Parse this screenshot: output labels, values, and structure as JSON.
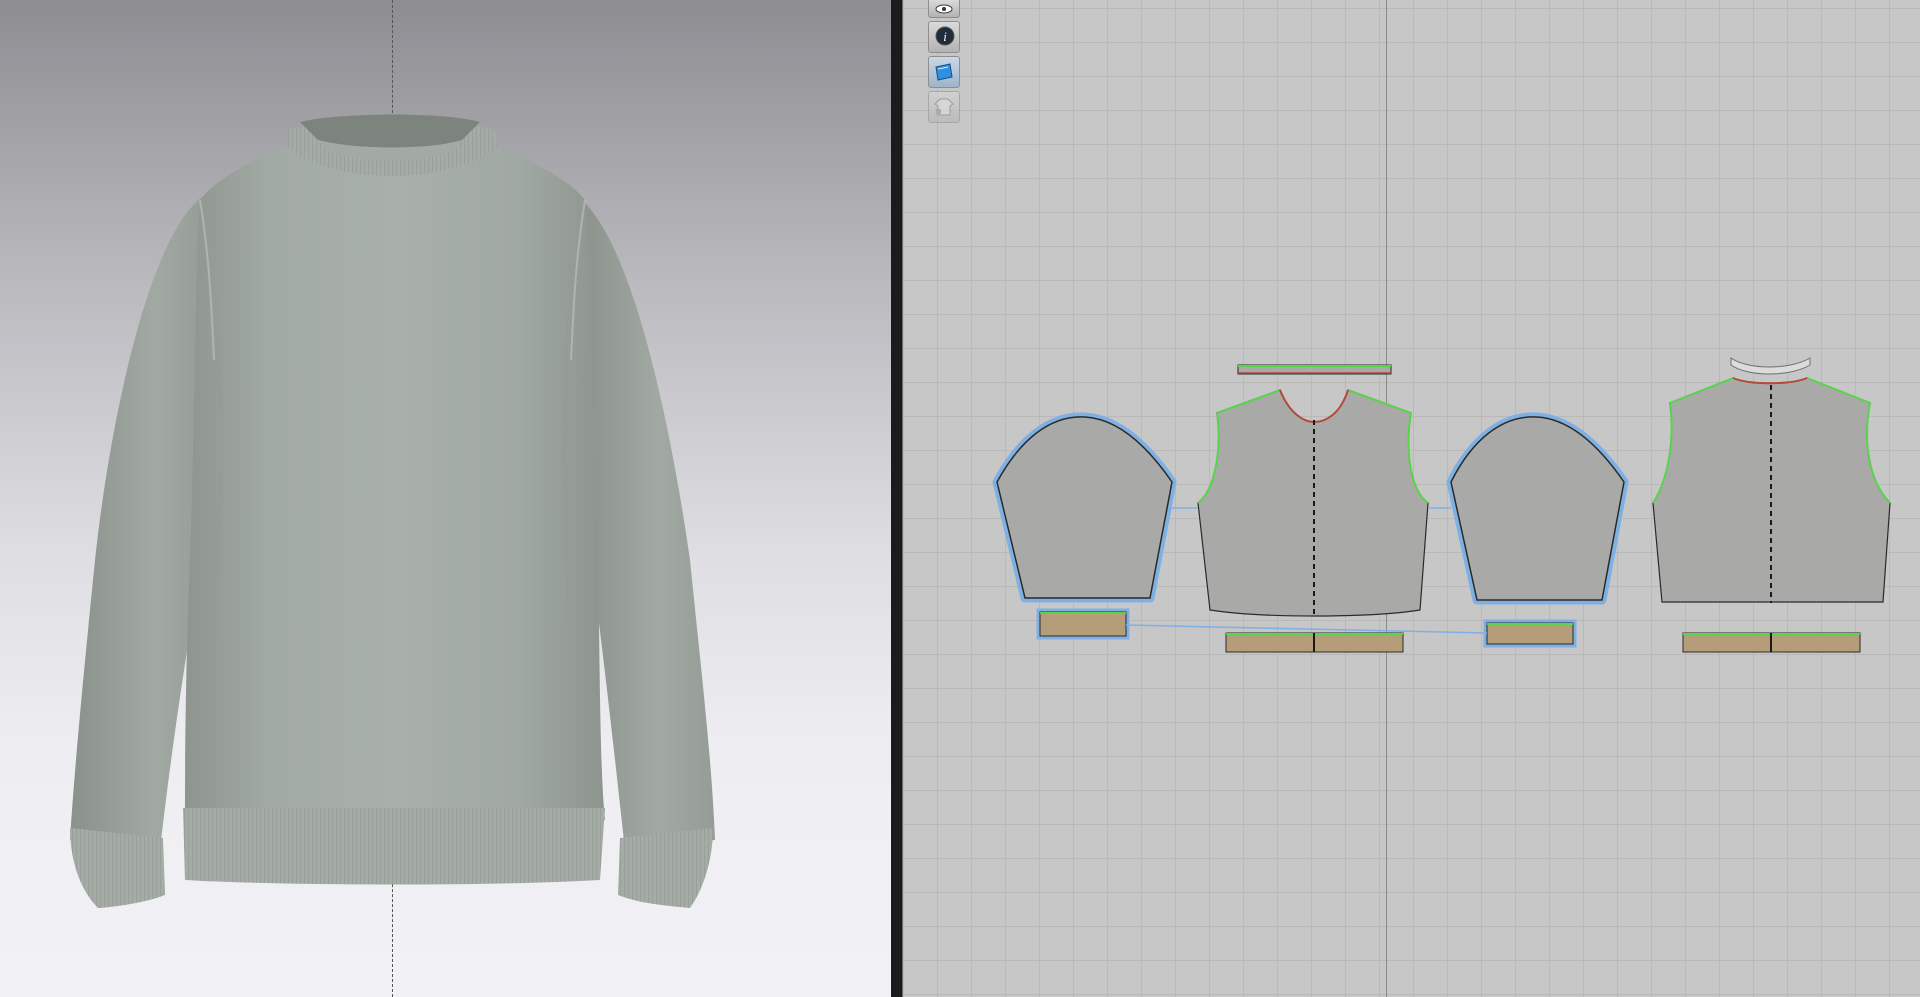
{
  "app": {
    "panes": [
      "3d-garment-window",
      "2d-pattern-window"
    ]
  },
  "viewport_3d": {
    "background_top": "#8d8d92",
    "background_bottom": "#f2f2f5",
    "garment_color": "#a2aaa4"
  },
  "viewport_2d": {
    "background": "#c7c7c7",
    "grid_color": "#b9b9b9",
    "toolbar": [
      {
        "icon": "eye-icon",
        "state": "normal"
      },
      {
        "icon": "info-icon",
        "state": "normal"
      },
      {
        "icon": "pattern-page-icon",
        "state": "active"
      },
      {
        "icon": "garment-lock-icon",
        "state": "disabled"
      }
    ],
    "pieces": [
      "left-sleeve",
      "front-body",
      "neck-rib-front",
      "right-sleeve",
      "back-body",
      "neck-rib-back",
      "left-cuff",
      "right-cuff",
      "front-hem-band",
      "back-hem-band"
    ],
    "colors": {
      "piece_fill": "#a9aaa8",
      "rib_fill": "#b59d7a",
      "selected_outline": "#7fb0e4",
      "sewing_line": "#5ad24d",
      "seam_red": "#b24a3a"
    }
  }
}
